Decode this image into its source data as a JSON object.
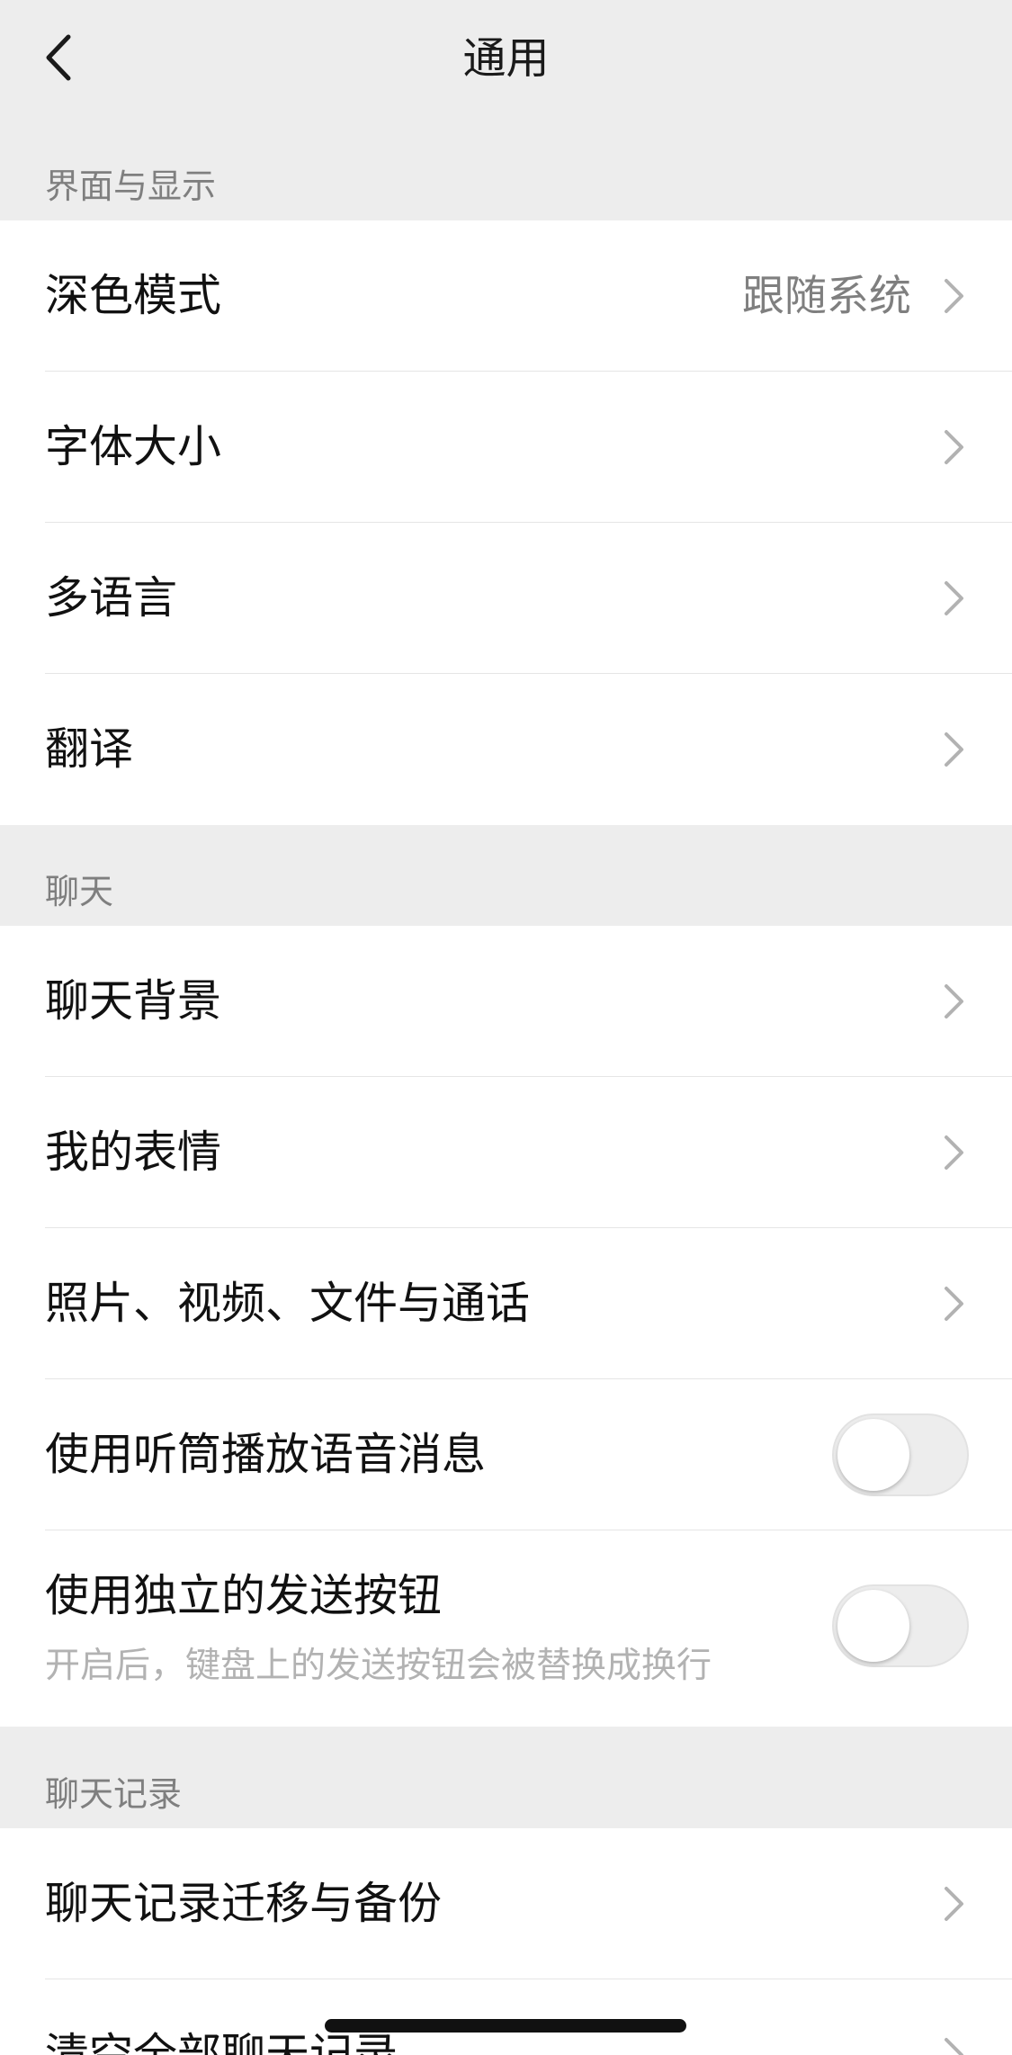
{
  "nav": {
    "title": "通用",
    "back_icon": "chevron-left-icon"
  },
  "sections": [
    {
      "header": "界面与显示",
      "items": [
        {
          "label": "深色模式",
          "value": "跟随系统",
          "accessory": "chevron"
        },
        {
          "label": "字体大小",
          "accessory": "chevron"
        },
        {
          "label": "多语言",
          "accessory": "chevron"
        },
        {
          "label": "翻译",
          "accessory": "chevron"
        }
      ]
    },
    {
      "header": "聊天",
      "items": [
        {
          "label": "聊天背景",
          "accessory": "chevron"
        },
        {
          "label": "我的表情",
          "accessory": "chevron"
        },
        {
          "label": "照片、视频、文件与通话",
          "accessory": "chevron"
        },
        {
          "label": "使用听筒播放语音消息",
          "accessory": "toggle",
          "on": false
        },
        {
          "label": "使用独立的发送按钮",
          "sublabel": "开启后，键盘上的发送按钮会被替换成换行",
          "accessory": "toggle",
          "on": false
        }
      ]
    },
    {
      "header": "聊天记录",
      "items": [
        {
          "label": "聊天记录迁移与备份",
          "accessory": "chevron"
        },
        {
          "label": "清空全部聊天记录",
          "accessory": "chevron"
        }
      ]
    }
  ],
  "colors": {
    "background": "#ededed",
    "cell": "#ffffff",
    "text_primary": "#111111",
    "text_secondary": "#7f7f7f",
    "toggle_off": "#ededed"
  }
}
